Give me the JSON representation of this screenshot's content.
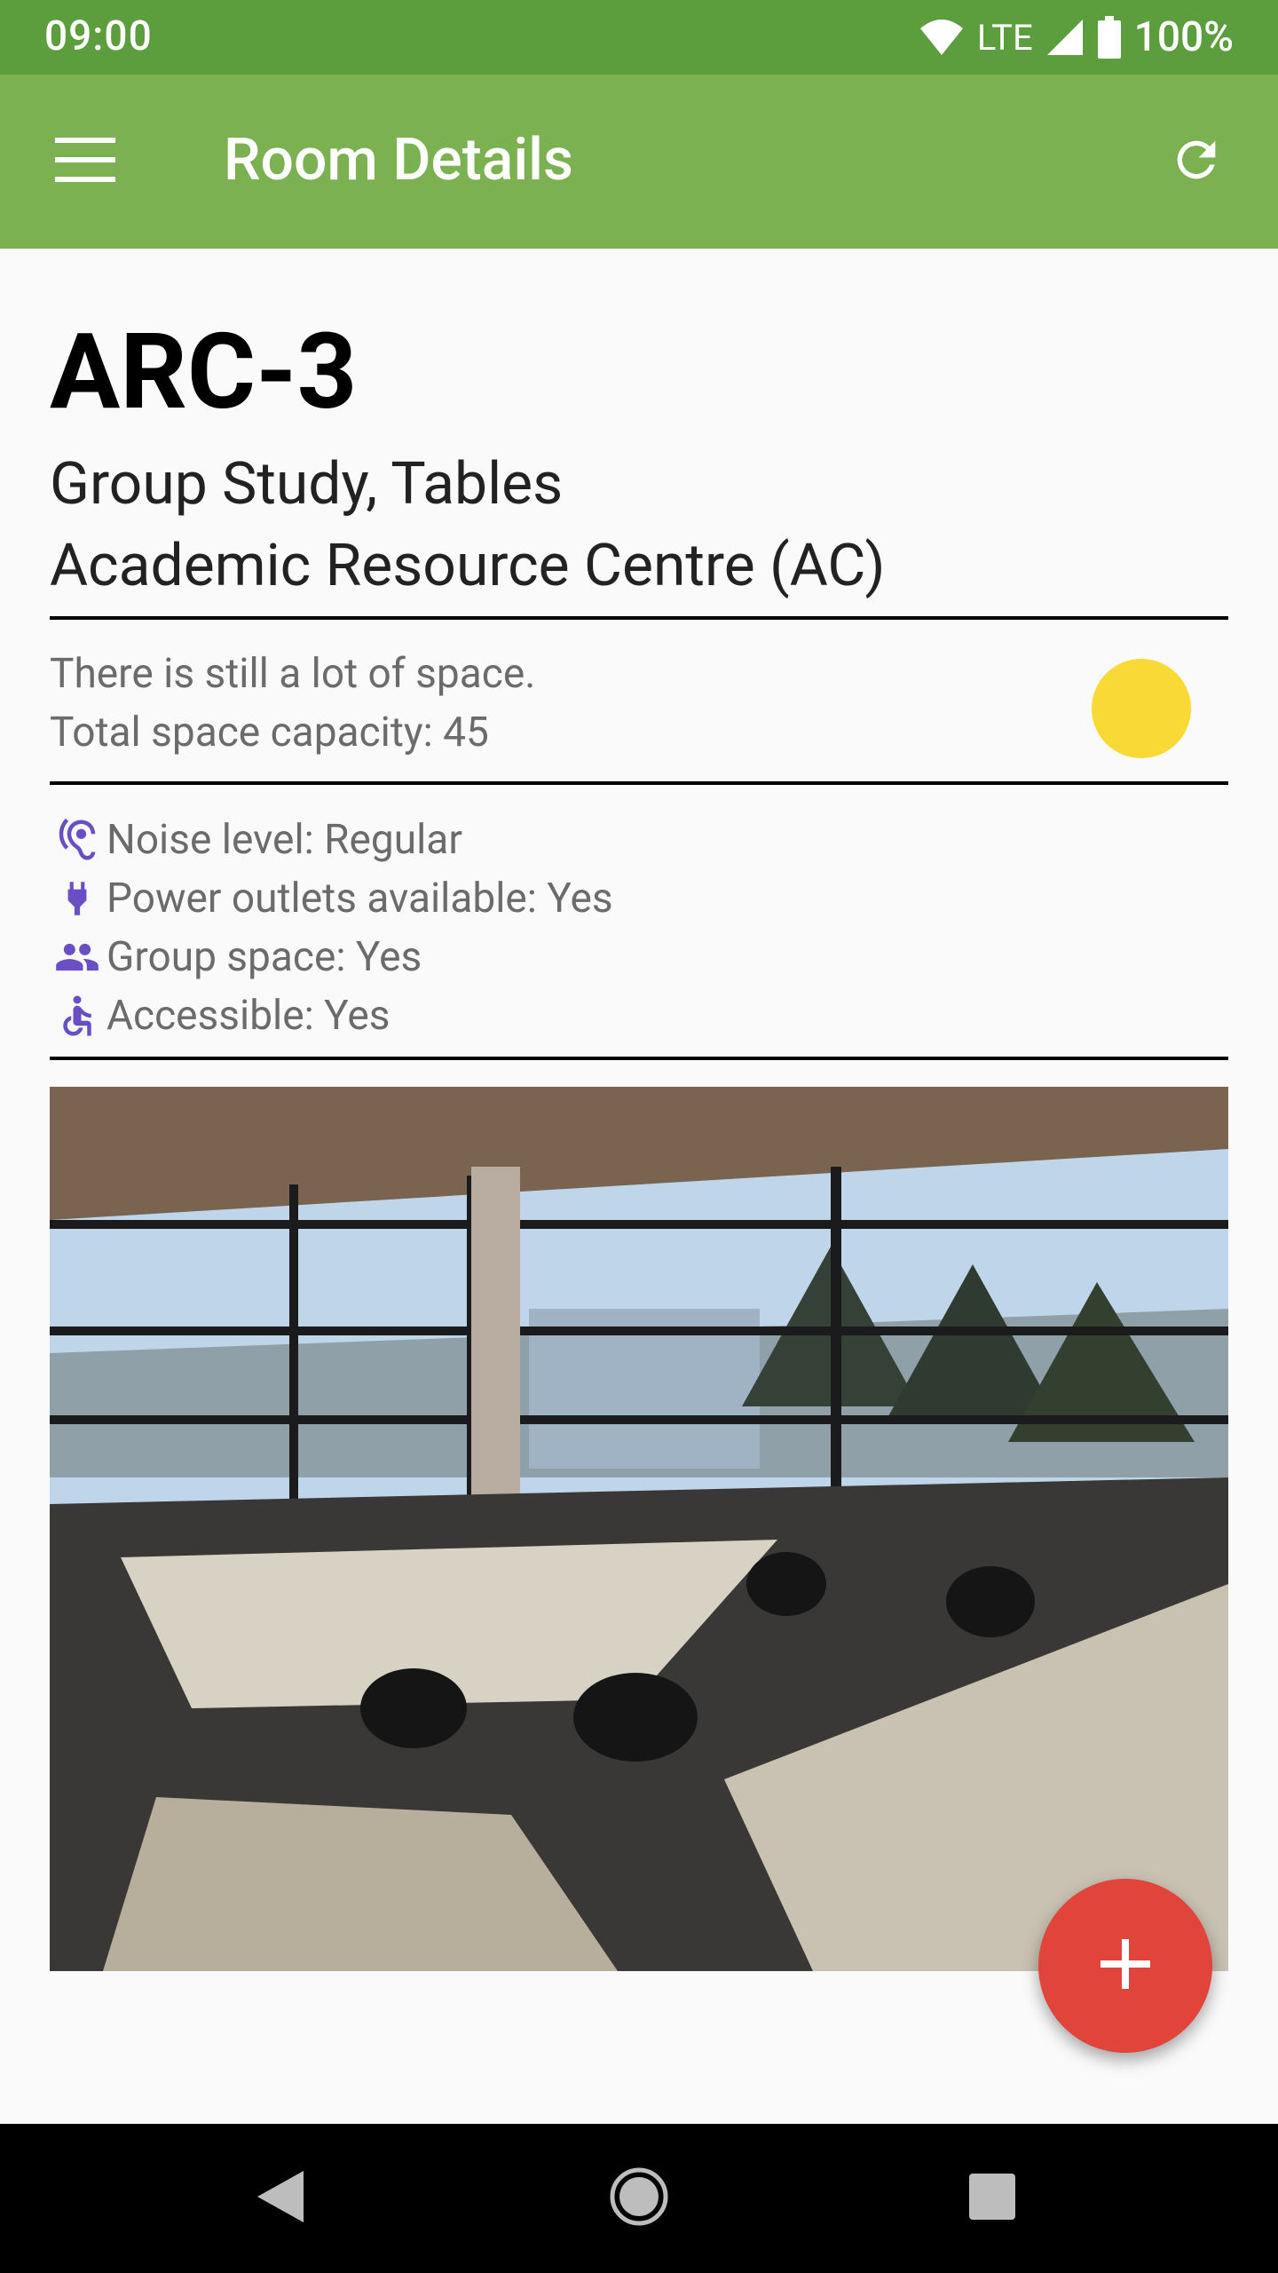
{
  "status_bar": {
    "time": "09:00",
    "network": "LTE",
    "battery": "100%"
  },
  "app_bar": {
    "title": "Room Details"
  },
  "room": {
    "name": "ARC-3",
    "type": "Group Study, Tables",
    "building": "Academic Resource Centre (AC)"
  },
  "capacity": {
    "status_text": "There is still a lot of space.",
    "total_text": "Total space capacity: 45",
    "indicator_color": "#f8d936"
  },
  "features": [
    {
      "icon": "hearing-icon",
      "text": "Noise level: Regular"
    },
    {
      "icon": "power-plug-icon",
      "text": "Power outlets available: Yes"
    },
    {
      "icon": "group-icon",
      "text": "Group space: Yes"
    },
    {
      "icon": "accessible-icon",
      "text": "Accessible: Yes"
    }
  ],
  "colors": {
    "status_bar": "#5c9e3e",
    "app_bar": "#7cb152",
    "fab": "#e0443a",
    "feature_icon": "#6a4fc4"
  }
}
